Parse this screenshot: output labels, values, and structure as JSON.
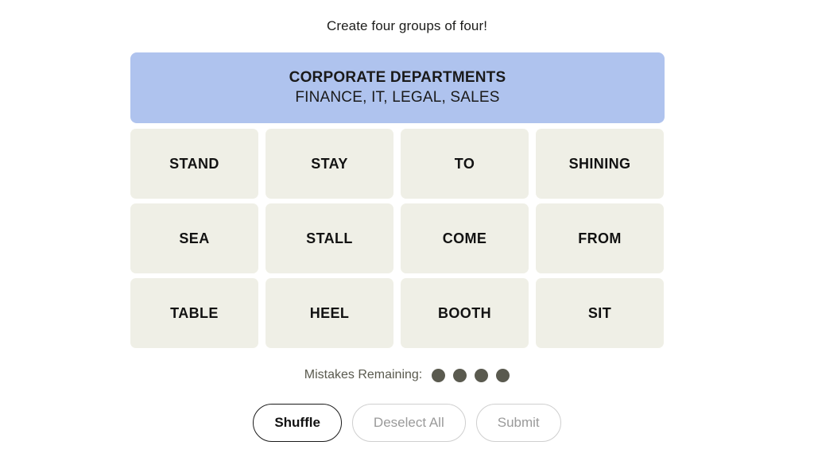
{
  "prompt": "Create four groups of four!",
  "solved_groups": [
    {
      "title": "CORPORATE DEPARTMENTS",
      "members": "FINANCE, IT, LEGAL, SALES",
      "color": "#afc3ee"
    }
  ],
  "grid": {
    "tile_color": "#efefe6",
    "rows": [
      [
        "STAND",
        "STAY",
        "TO",
        "SHINING"
      ],
      [
        "SEA",
        "STALL",
        "COME",
        "FROM"
      ],
      [
        "TABLE",
        "HEEL",
        "BOOTH",
        "SIT"
      ]
    ]
  },
  "mistakes": {
    "label": "Mistakes Remaining:",
    "remaining": 4,
    "dot_color": "#5a5a4f"
  },
  "controls": {
    "shuffle": {
      "label": "Shuffle",
      "enabled": true
    },
    "deselect_all": {
      "label": "Deselect All",
      "enabled": false
    },
    "submit": {
      "label": "Submit",
      "enabled": false
    }
  }
}
